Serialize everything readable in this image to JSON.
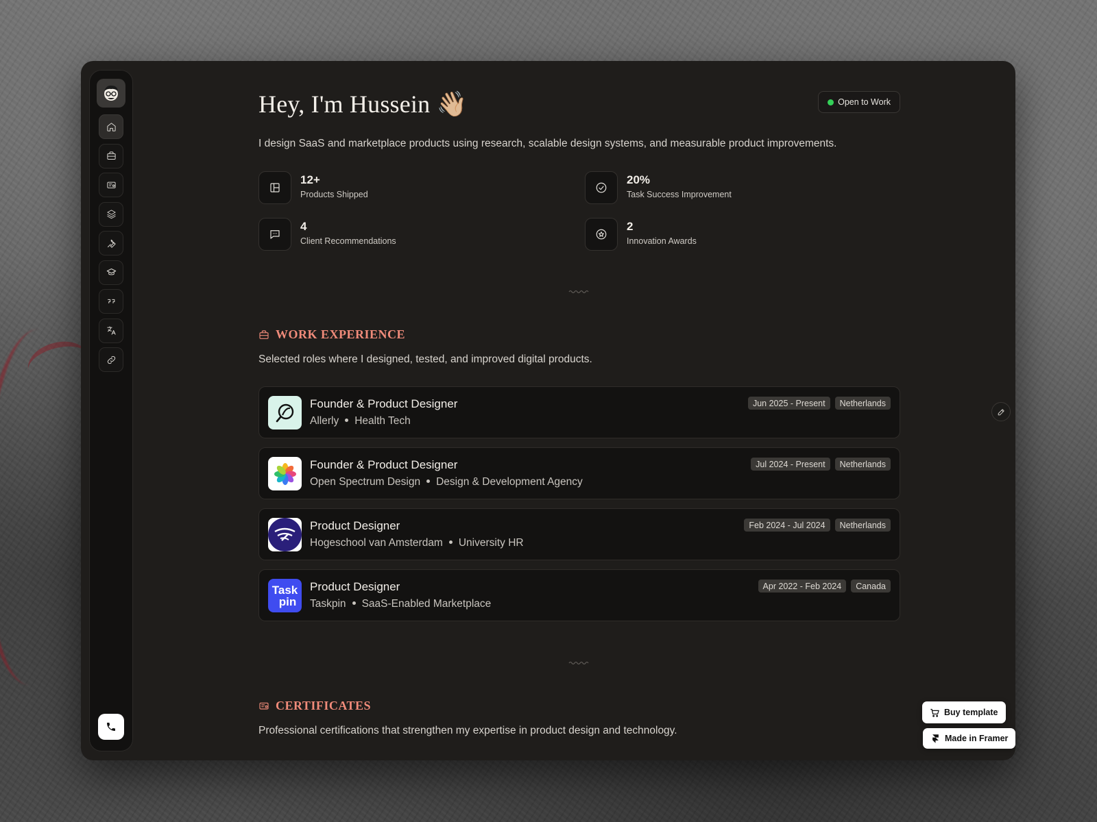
{
  "hero": {
    "title": "Hey, I'm Hussein 👋🏼",
    "status": "Open to Work",
    "intro": "I design SaaS and marketplace products using research, scalable design systems, and measurable product improvements."
  },
  "stats": [
    {
      "value": "12+",
      "label": "Products Shipped",
      "icon": "layout-icon"
    },
    {
      "value": "20%",
      "label": "Task Success Improvement",
      "icon": "check-circle-icon"
    },
    {
      "value": "4",
      "label": "Client Recommendations",
      "icon": "message-icon"
    },
    {
      "value": "2",
      "label": "Innovation Awards",
      "icon": "award-icon"
    }
  ],
  "work": {
    "title": "WORK EXPERIENCE",
    "description": "Selected roles where I designed, tested, and improved digital products.",
    "jobs": [
      {
        "title": "Founder & Product Designer",
        "company": "Allerly",
        "industry": "Health Tech",
        "dates": "Jun 2025 - Present",
        "location": "Netherlands"
      },
      {
        "title": "Founder & Product Designer",
        "company": "Open Spectrum Design",
        "industry": "Design & Development Agency",
        "dates": "Jul 2024 - Present",
        "location": "Netherlands"
      },
      {
        "title": "Product Designer",
        "company": "Hogeschool van Amsterdam",
        "industry": "University HR",
        "dates": "Feb 2024 - Jul 2024",
        "location": "Netherlands"
      },
      {
        "title": "Product Designer",
        "company": "Taskpin",
        "industry": "SaaS-Enabled Marketplace",
        "dates": "Apr 2022 - Feb 2024",
        "location": "Canada",
        "logo_text_1": "Task",
        "logo_text_2": "pin"
      }
    ]
  },
  "certificates": {
    "title": "CERTIFICATES",
    "description": "Professional certifications that strengthen my expertise in product design and technology."
  },
  "floating": {
    "buy": "Buy template",
    "framer": "Made in Framer"
  },
  "colors": {
    "accent": "#f08b7a",
    "status_dot": "#34d058",
    "taskpin_blue": "#3f4cf0",
    "hva_navy": "#2a1f7a"
  }
}
